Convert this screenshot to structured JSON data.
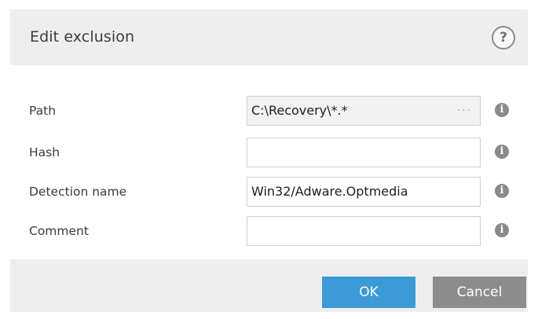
{
  "dialog": {
    "title": "Edit exclusion",
    "help_label": "?"
  },
  "fields": [
    {
      "label": "Path",
      "value": "C:\\Recovery\\*.*",
      "browse_label": "...",
      "info": "i"
    },
    {
      "label": "Hash",
      "value": "",
      "info": "i"
    },
    {
      "label": "Detection name",
      "value": "Win32/Adware.Optmedia",
      "info": "i"
    },
    {
      "label": "Comment",
      "value": "",
      "info": "i"
    }
  ],
  "footer": {
    "ok_label": "OK",
    "cancel_label": "Cancel"
  },
  "colors": {
    "header_bg": "#eeeeee",
    "ok_button": "#3a9bd6",
    "cancel_button": "#8c8c8c",
    "info_icon": "#8a8a8a"
  }
}
